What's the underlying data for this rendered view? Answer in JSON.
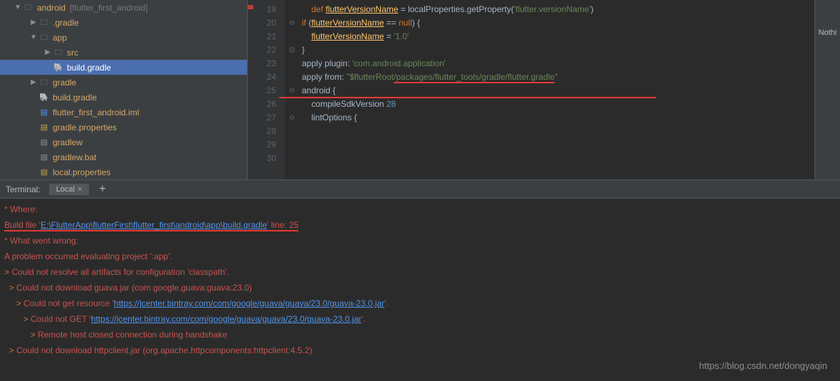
{
  "tree": {
    "root": {
      "label": "android",
      "annotation": "[flutter_first_android]"
    },
    "items": [
      {
        "indent": 40,
        "arrow": "▶",
        "icon": "folder",
        "label": ".gradle"
      },
      {
        "indent": 40,
        "arrow": "▼",
        "icon": "folder",
        "label": "app"
      },
      {
        "indent": 60,
        "arrow": "▶",
        "icon": "folder",
        "label": "src"
      },
      {
        "indent": 60,
        "arrow": "",
        "icon": "gradle",
        "label": "build.gradle",
        "selected": true
      },
      {
        "indent": 40,
        "arrow": "▶",
        "icon": "folder",
        "label": "gradle"
      },
      {
        "indent": 40,
        "arrow": "",
        "icon": "gradle",
        "label": "build.gradle"
      },
      {
        "indent": 40,
        "arrow": "",
        "icon": "file-blue",
        "label": "flutter_first_android.iml"
      },
      {
        "indent": 40,
        "arrow": "",
        "icon": "file-yellow",
        "label": "gradle.properties"
      },
      {
        "indent": 40,
        "arrow": "",
        "icon": "file",
        "label": "gradlew"
      },
      {
        "indent": 40,
        "arrow": "",
        "icon": "file",
        "label": "gradlew.bat"
      },
      {
        "indent": 40,
        "arrow": "",
        "icon": "file-yellow",
        "label": "local.properties"
      }
    ]
  },
  "editor": {
    "lines": [
      {
        "num": 19,
        "segments": [
          {
            "t": "    "
          },
          {
            "t": "def ",
            "c": "kw"
          },
          {
            "t": "flutterVersionName",
            "c": "func"
          },
          {
            "t": " = localProperties.getProperty("
          },
          {
            "t": "'flutter.versionName'",
            "c": "str"
          },
          {
            "t": ")"
          }
        ]
      },
      {
        "num": 20,
        "fold": "⊖",
        "segments": [
          {
            "t": "if",
            "c": "kw"
          },
          {
            "t": " ("
          },
          {
            "t": "flutterVersionName",
            "c": "func"
          },
          {
            "t": " == "
          },
          {
            "t": "null",
            "c": "kw"
          },
          {
            "t": ") {"
          }
        ]
      },
      {
        "num": 21,
        "segments": [
          {
            "t": "    "
          },
          {
            "t": "flutterVersionName",
            "c": "func"
          },
          {
            "t": " = "
          },
          {
            "t": "'1.0'",
            "c": "str"
          }
        ]
      },
      {
        "num": 22,
        "fold": "⊟",
        "segments": [
          {
            "t": "}"
          }
        ]
      },
      {
        "num": 23,
        "segments": [
          {
            "t": ""
          }
        ]
      },
      {
        "num": 24,
        "segments": [
          {
            "t": "apply "
          },
          {
            "t": "plugin",
            "c": "ident"
          },
          {
            "t": ": "
          },
          {
            "t": "'com.android.application'",
            "c": "str"
          }
        ]
      },
      {
        "num": 25,
        "segments": [
          {
            "t": "apply "
          },
          {
            "t": "from",
            "c": "ident"
          },
          {
            "t": ": "
          },
          {
            "t": "\"",
            "c": "str"
          },
          {
            "t": "$flutterRoot",
            "c": "str"
          },
          {
            "t": "/packages/flutter_tools/gradle/flutter.gradle",
            "c": "str red-underline"
          },
          {
            "t": "\"",
            "c": "str"
          }
        ]
      },
      {
        "num": 26,
        "segments": [
          {
            "t": ""
          }
        ]
      },
      {
        "num": 27,
        "fold": "⊖",
        "segments": [
          {
            "t": "android {"
          }
        ]
      },
      {
        "num": 28,
        "segments": [
          {
            "t": "    compileSdkVersion "
          },
          {
            "t": "28",
            "c": "num"
          }
        ]
      },
      {
        "num": 29,
        "segments": [
          {
            "t": ""
          }
        ]
      },
      {
        "num": 30,
        "fold": "⊖",
        "segments": [
          {
            "t": "    lintOptions {"
          }
        ]
      }
    ]
  },
  "right_pane": {
    "text": "Nothi"
  },
  "terminal": {
    "label": "Terminal:",
    "tab": "Local",
    "lines": [
      {
        "segments": [
          {
            "t": "* Where:"
          }
        ]
      },
      {
        "segments": [
          {
            "t": "Build file '",
            "u": true
          },
          {
            "t": "E:\\FlutterApp\\flutterFirst\\flutter_first\\android\\app\\build.gradle",
            "c": "term-link",
            "u": true
          },
          {
            "t": "' line: 25",
            "u": true
          }
        ]
      },
      {
        "segments": [
          {
            "t": ""
          }
        ]
      },
      {
        "segments": [
          {
            "t": "* What went wrong:"
          }
        ]
      },
      {
        "segments": [
          {
            "t": "A problem occurred evaluating project ':app'."
          }
        ]
      },
      {
        "segments": [
          {
            "t": "> ",
            "c": "gt"
          },
          {
            "t": "Could not resolve all artifacts for configuration 'classpath'."
          }
        ]
      },
      {
        "segments": [
          {
            "t": "  > ",
            "c": "gt"
          },
          {
            "t": "Could not download guava.jar (com.google.guava:guava:23.0)"
          }
        ]
      },
      {
        "segments": [
          {
            "t": "     > ",
            "c": "gt"
          },
          {
            "t": "Could not get resource '"
          },
          {
            "t": "https://jcenter.bintray.com/com/google/guava/guava/23.0/guava-23.0.jar",
            "c": "term-link"
          },
          {
            "t": "'."
          }
        ]
      },
      {
        "segments": [
          {
            "t": "        > ",
            "c": "gt"
          },
          {
            "t": "Could not GET '"
          },
          {
            "t": "https://jcenter.bintray.com/com/google/guava/guava/23.0/guava-23.0.jar",
            "c": "term-link"
          },
          {
            "t": "'."
          }
        ]
      },
      {
        "segments": [
          {
            "t": "           > ",
            "c": "gt"
          },
          {
            "t": "Remote host closed connection during handshake"
          }
        ]
      },
      {
        "segments": [
          {
            "t": "  > ",
            "c": "gt"
          },
          {
            "t": "Could not download httpclient.jar (org.apache.httpcomponents:httpclient:4.5.2)"
          }
        ]
      }
    ]
  },
  "watermark": "https://blog.csdn.net/dongyaqin"
}
